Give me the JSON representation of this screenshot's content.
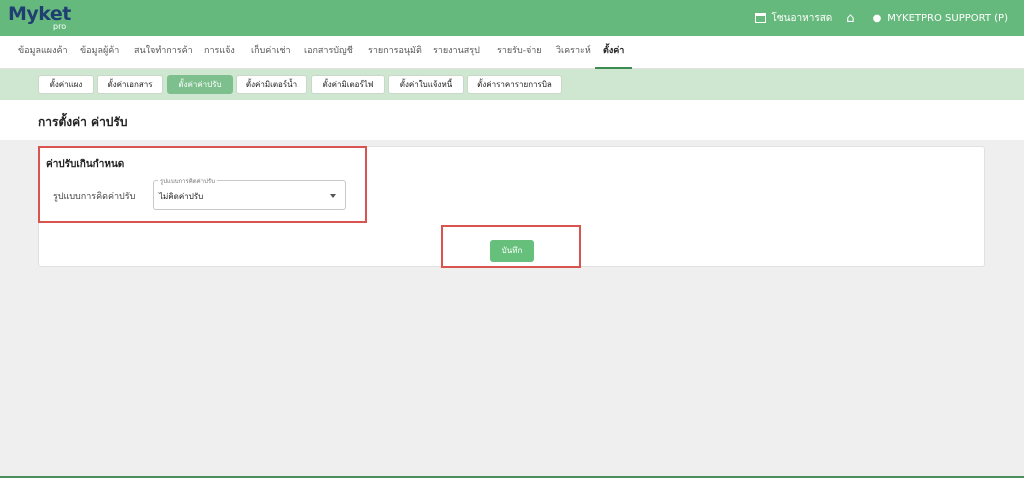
{
  "header": {
    "logo_text": "Myket",
    "logo_sub": "pro",
    "store_name": "โซนอาหารสด",
    "user_name": "MYKETPRO SUPPORT (P)"
  },
  "main_nav": [
    {
      "label": "ข้อมูลแผงค้า"
    },
    {
      "label": "ข้อมูลผู้ค้า"
    },
    {
      "label": "สนใจทำการค้า"
    },
    {
      "label": "การแจ้ง"
    },
    {
      "label": "เก็บค่าเช่า"
    },
    {
      "label": "เอกสารบัญชี"
    },
    {
      "label": "รายการอนุมัติ"
    },
    {
      "label": "รายงานสรุป"
    },
    {
      "label": "รายรับ-จ่าย"
    },
    {
      "label": "วิเคราะห์"
    },
    {
      "label": "ตั้งค่า",
      "active": true
    }
  ],
  "sub_nav": [
    {
      "label": "ตั้งค่าแผง"
    },
    {
      "label": "ตั้งค่าเอกสาร"
    },
    {
      "label": "ตั้งค่าค่าปรับ",
      "active": true
    },
    {
      "label": "ตั้งค่ามิเตอร์น้ำ"
    },
    {
      "label": "ตั้งค่ามิเตอร์ไฟ"
    },
    {
      "label": "ตั้งค่าใบแจ้งหนี้"
    },
    {
      "label": "ตั้งค่าราคารายการบิล"
    }
  ],
  "page": {
    "title": "การตั้งค่า ค่าปรับ",
    "section_title": "ค่าปรับเกินกำหนด",
    "field_label": "รูปแบบการคิดค่าปรับ",
    "select_caption": "รูปแบบการคิดค่าปรับ",
    "select_value": "ไม่คิดค่าปรับ",
    "save_label": "บันทึก"
  },
  "colors": {
    "topbar": "#66b97c",
    "accent_green": "#66c07c",
    "subnav_bg": "#cfe6d0",
    "highlight_red": "#d9534f"
  }
}
